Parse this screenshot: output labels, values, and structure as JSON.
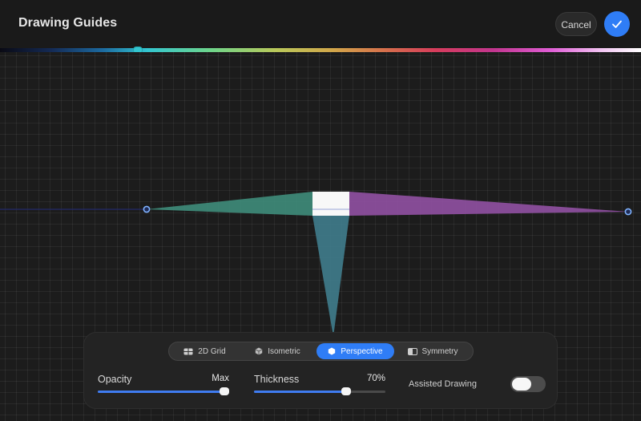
{
  "header": {
    "title": "Drawing Guides",
    "cancel_label": "Cancel",
    "confirm_icon": "checkmark-icon"
  },
  "colors": {
    "accent": "#2f7df6",
    "guide_color": "#33c6d0",
    "left_vanishing_fill": "#3e8a78",
    "right_vanishing_fill": "#8e4f9f",
    "down_vanishing_fill": "#3f7b8a"
  },
  "guide_color_slider": {
    "value": 0.215
  },
  "guide_types": {
    "options": [
      {
        "label": "2D Grid",
        "icon": "grid-icon"
      },
      {
        "label": "Isometric",
        "icon": "cube-icon"
      },
      {
        "label": "Perspective",
        "icon": "perspective-cube-icon"
      },
      {
        "label": "Symmetry",
        "icon": "symmetry-icon"
      }
    ],
    "selected": "Perspective"
  },
  "sliders": {
    "opacity": {
      "label": "Opacity",
      "value_text": "Max",
      "fraction": 1.0
    },
    "thickness": {
      "label": "Thickness",
      "value_text": "70%",
      "fraction": 0.7
    }
  },
  "assisted_drawing": {
    "label": "Assisted Drawing",
    "enabled": false
  }
}
